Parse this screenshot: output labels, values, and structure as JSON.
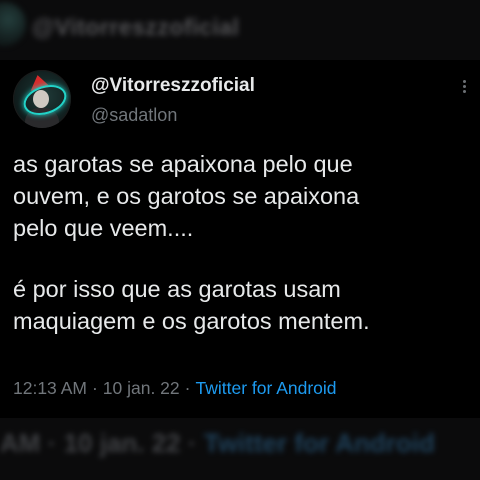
{
  "background": {
    "blurred_name": "@Vitorreszzoficial",
    "blurred_meta": {
      "time": "AM",
      "date": "10 jan. 22",
      "app": "Twitter for Android"
    }
  },
  "tweet": {
    "display_name": "@Vitorreszzoficial",
    "handle": "@sadatlon",
    "paragraph_1": "as garotas se apaixona pelo que\nouvem, e os garotos se apaixona\npelo que veem....",
    "paragraph_2": "é por isso que as garotas usam\nmaquiagem e os garotos mentem.",
    "time": "12:13 AM",
    "separator": "·",
    "date": "10 jan. 22",
    "app": "Twitter for Android"
  },
  "icons": {
    "avatar": "profile-avatar",
    "more": "more-options-icon"
  },
  "colors": {
    "text_primary": "#e7e9ea",
    "text_secondary": "#71767b",
    "link": "#1d9bf0",
    "background": "#000000"
  }
}
